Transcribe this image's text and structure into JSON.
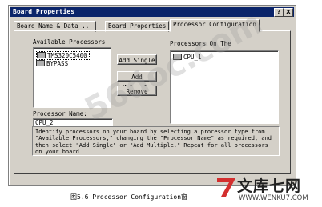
{
  "window": {
    "title": "Board Properties",
    "help_btn": "?",
    "close_btn": "X"
  },
  "tabs": [
    {
      "label": "Board Name & Data ..."
    },
    {
      "label": "Board Properties"
    },
    {
      "label": "Processor Configuration"
    }
  ],
  "available": {
    "label": "Available Processors:",
    "items": [
      "TMS320C5400",
      "BYPASS"
    ]
  },
  "on_board": {
    "label": "Processors On The",
    "items": [
      "CPU_1"
    ]
  },
  "buttons": {
    "add_single": "Add Single",
    "add_multiple": "Add Multiple",
    "remove": "Remove"
  },
  "processor_name": {
    "label": "Processor Name:",
    "value": "CPU_2"
  },
  "help_text": "Identify processors on your board by selecting a processor type from \"Available Processors,\" changing the \"Processor Name\" as required, and then select \"Add Single\" or \"Add Multiple.\"  Repeat for all processors on your board",
  "watermark": "56doc.com",
  "caption": "图5.6  Processor Configuration窗",
  "brand": {
    "name": "文库七网",
    "url": "WWW.WENKU7.COM"
  }
}
